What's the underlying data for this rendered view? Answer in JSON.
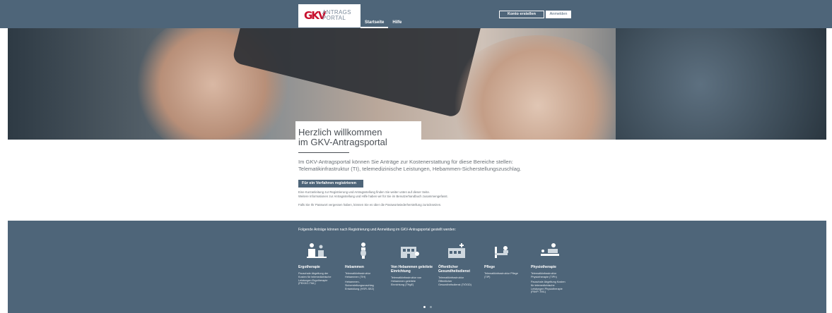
{
  "header": {
    "logo_mark": "GKV",
    "logo_line1": "ANTRAGS",
    "logo_line2": "PORTAL",
    "nav": [
      {
        "label": "Startseite"
      },
      {
        "label": "Hilfe"
      }
    ],
    "register_label": "Konto erstellen",
    "login_label": "Anmelden"
  },
  "welcome": {
    "title_line1": "Herzlich willkommen",
    "title_line2": "im GKV-Antragsportal",
    "intro_line1": "Im GKV-Antragsportal können Sie Anträge zur Kostenerstattung für diese Bereiche stellen:",
    "intro_line2": "Telematikinfrastruktur (TI), telemedizinische Leistungen, Hebammen-Sicherstellungszuschlag.",
    "cta_label": "Für ein Verfahren registrieren",
    "info_line1": "Eine Kurzanleitung zur Registrierung und Antragsstellung finden Sie weiter unten auf dieser Seite.",
    "info_line2": "Weitere Informationen zur Antragsstellung und Hilfe haben wir für Sie im Benutzerhandbuch zusammengefasst.",
    "password_text": "Falls Sie Ihr Passwort vergessen haben, können Sie es über die Passwortwiederherstellung zurücksetzen."
  },
  "band": {
    "heading": "Folgende Anträge können nach Registrierung und Anmeldung im GKV-Antragsportal gestellt werden:",
    "cards": [
      {
        "icon": "therapist-icon",
        "title": "Ergotherapie",
        "desc1": "Pauschale Abgeltung der Kosten für telemedizinische Leistungen Ergotherapie (PEKKO-TML)",
        "desc2": ""
      },
      {
        "icon": "midwife-icon",
        "title": "Hebammen",
        "desc1": "Telematikinfrastruktur Hebammen (TIH)",
        "desc2": "Hebammen-Sicherstellungszuschlag Entwicklung (HSFI-SEZ)"
      },
      {
        "icon": "facility-icon",
        "title": "Von Hebammen geleitete Einrichtung",
        "desc1": "Telematikinfrastruktur von Hebammen geleitete Einrichtung (THgE)",
        "desc2": ""
      },
      {
        "icon": "public-health-icon",
        "title": "Öffentlicher Gesundheitsdienst",
        "desc1": "Telematikinfrastruktur Öffentlicher Gesundheitsdienst (TIÖGD)",
        "desc2": ""
      },
      {
        "icon": "care-icon",
        "title": "Pflege",
        "desc1": "Telematikinfrastruktur Pflege (TIP)",
        "desc2": ""
      },
      {
        "icon": "physio-icon",
        "title": "Physiotherapie",
        "desc1": "Telematikinfrastruktur Physiotherapie (TIPh)",
        "desc2": "Pauschale Abgeltung Kosten für telemedizinische Leistungen Physiotherapie (PAVP-TML)"
      }
    ]
  },
  "colors": {
    "header_bg": "#4e6579",
    "accent_red": "#c8102e",
    "text": "#4a4f55"
  }
}
